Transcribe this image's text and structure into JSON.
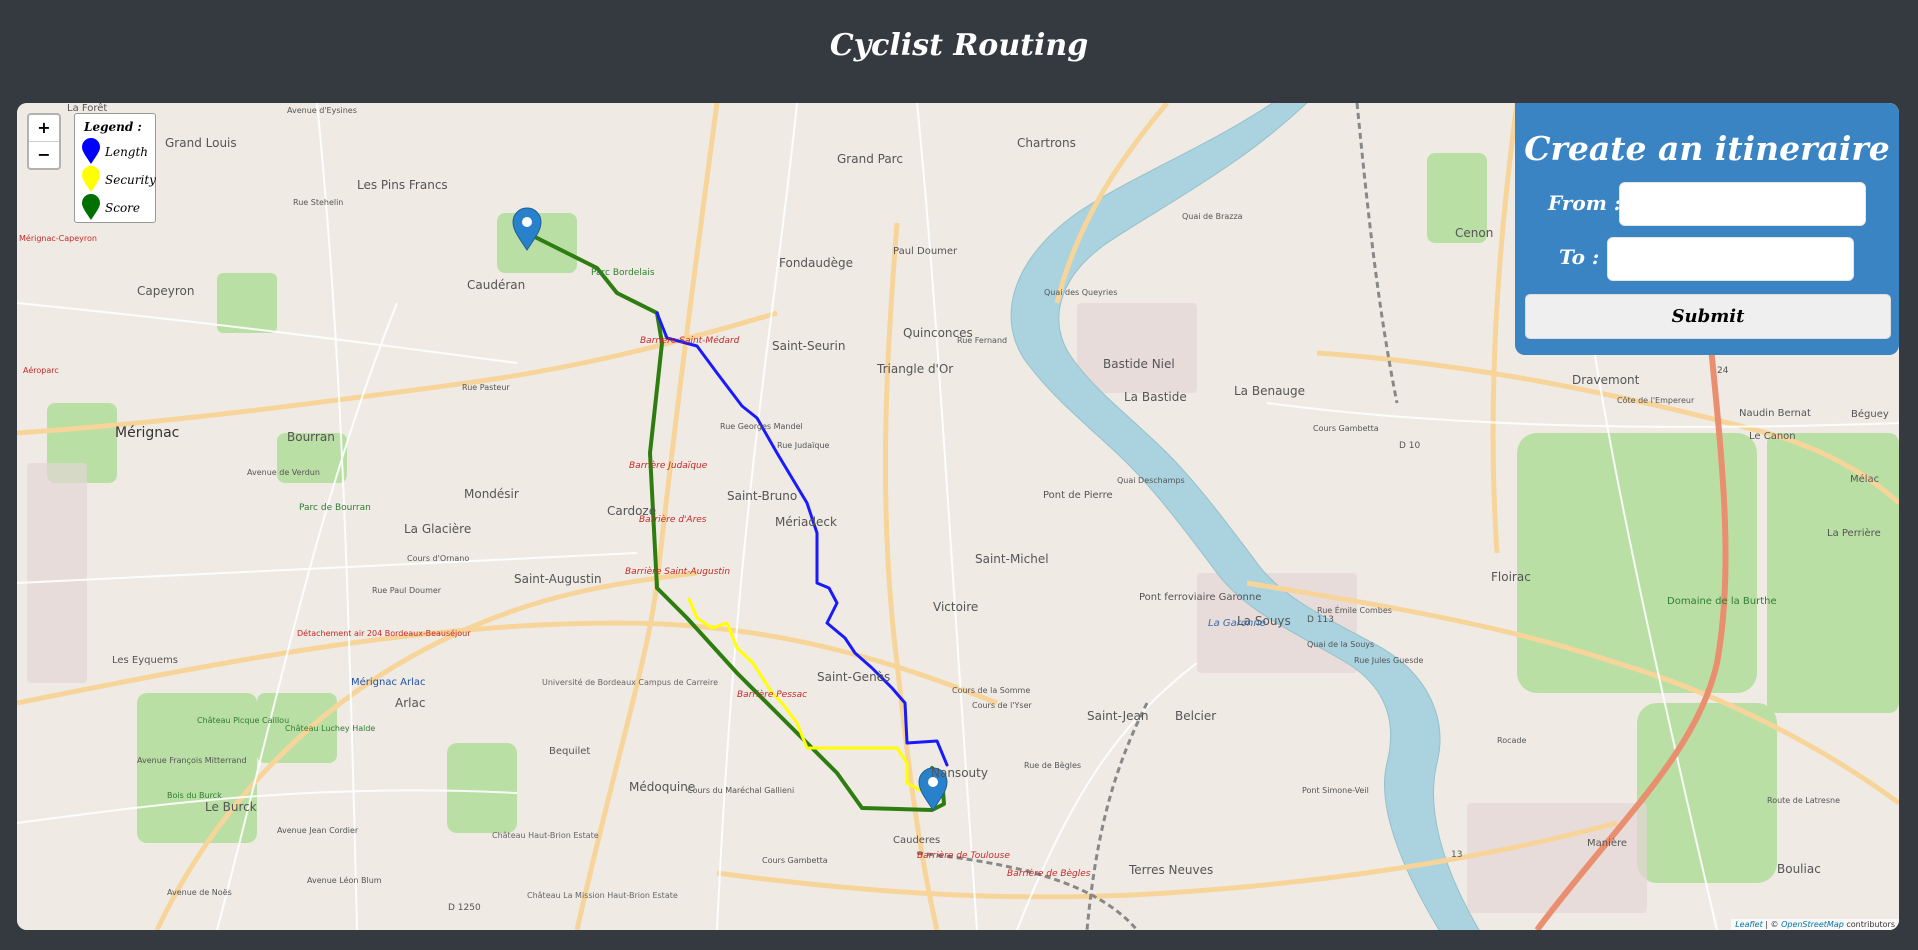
{
  "header": {
    "title": "Cyclist Routing"
  },
  "map": {
    "zoom_in": "+",
    "zoom_out": "−",
    "legend": {
      "title": "Legend :",
      "items": [
        {
          "label": "Length",
          "color": "#0000ff"
        },
        {
          "label": "Security",
          "color": "#ffff00"
        },
        {
          "label": "Score",
          "color": "#007000"
        }
      ]
    },
    "attribution": {
      "leaflet": "Leaflet",
      "sep": " | © ",
      "osm": "OpenStreetMap",
      "suffix": " contributors"
    },
    "route_colors": {
      "length": "#1a1aff",
      "security": "#ffff00",
      "score": "#2e7d10"
    },
    "labels": [
      "Grand Louis",
      "Les Pins Francs",
      "Caudéran",
      "Capeyron",
      "Mérignac",
      "Bourran",
      "Mondésir",
      "Cardoze",
      "La Glacière",
      "Saint-Augustin",
      "Parc de Bourran",
      "Les Eyquems",
      "Mérignac Arlac",
      "Arlac",
      "Le Burck",
      "Médoquine",
      "Bequilet",
      "Grand Parc",
      "Chartrons",
      "Fondaudège",
      "Paul Doumer",
      "Saint-Seurin",
      "Quinconces",
      "Triangle d'Or",
      "Saint-Bruno",
      "Mériadeck",
      "Saint-Michel",
      "Victoire",
      "Saint-Genès",
      "Nansouty",
      "Saint-Jean",
      "Belcier",
      "Terres Neuves",
      "Bastide Niel",
      "La Bastide",
      "La Benauge",
      "Cenon",
      "Dravemont",
      "Floirac",
      "La Souys",
      "Pont de Pierre",
      "Pont ferroviaire Garonne",
      "Domaine de la Burthe",
      "Bouliac",
      "Manière",
      "La Perrière",
      "Mélac",
      "Béguey",
      "Le Canon",
      "Naudin Bernat",
      "Parc Bordelais",
      "Cauderes",
      "La Garonne",
      "Barrière Saint-Médard",
      "Barrière Judaïque",
      "Barrière d'Ares",
      "Barrière Saint-Augustin",
      "Barrière Pessac",
      "Barrière de Toulouse",
      "Barrière de Bègles",
      "Université de Bordeaux Campus de Carreire",
      "Château Haut-Brion Estate",
      "Château La Mission Haut-Brion Estate",
      "Détachement air 204 Bordeaux-Beauséjour",
      "Château Picque Caillou",
      "Château Luchey Halde",
      "Bois du Burck",
      "Rue Stehelin",
      "Avenue de Verdun",
      "Cours d'Ornano",
      "Rue Paul Doumer",
      "Avenue Jean Cordier",
      "Avenue Léon Blum",
      "Avenue de Noës",
      "Cours Gambetta",
      "Cours de l'Yser",
      "Cours de la Somme",
      "Rue de Bègles",
      "Cours du Maréchal Gallieni",
      "Rue Georges Mandel",
      "Rue Judaïque",
      "Rue Pasteur",
      "Avenue d'Eysines",
      "Quai de Brazza",
      "Quai des Queyries",
      "Quai Deschamps",
      "Quai de la Souys",
      "Pont Simone-Veil",
      "Rue Émile Combes",
      "Rue Jules Guesde",
      "Cours Gambetta",
      "Côte de l'Empereur",
      "Rocade",
      "D 10",
      "D 113",
      "D 1250",
      "13",
      "24",
      "La Forêt",
      "Mérignac-Capeyron",
      "Aéroparc",
      "Avenue François Mitterrand",
      "Rue Fernand",
      "Route de Latresne"
    ]
  },
  "form": {
    "title": "Create an itineraire :",
    "from_label": "From :",
    "to_label": "To :",
    "from_value": "",
    "to_value": "",
    "submit_label": "Submit"
  }
}
